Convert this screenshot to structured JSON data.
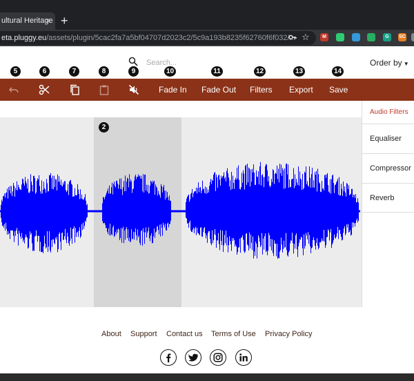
{
  "browser": {
    "tab_title": "ultural Heritage",
    "tab_close": "×",
    "new_tab": "+",
    "url_host": "eta.pluggy.eu",
    "url_path": "/assets/plugin/5cac2fa7a5bf04707d2023c2/5c9a193b8235f62760f6f032/..."
  },
  "extensions": [
    {
      "label": "M",
      "color": "#c0392b"
    },
    {
      "label": "",
      "color": "#2ecc71"
    },
    {
      "label": "",
      "color": "#3498db"
    },
    {
      "label": "",
      "color": "#27ae60"
    },
    {
      "label": "G",
      "color": "#16a085"
    },
    {
      "label": "SC",
      "color": "#e67e22"
    },
    {
      "label": "",
      "color": "#7f8c8d"
    }
  ],
  "header": {
    "search_placeholder": "Search...",
    "order_by": "Order by",
    "order_caret": "▼"
  },
  "badges": [
    "5",
    "6",
    "7",
    "8",
    "9",
    "10",
    "11",
    "12",
    "13",
    "14"
  ],
  "selection_badge": "2",
  "toolbar": {
    "fade_in": "Fade In",
    "fade_out": "Fade Out",
    "filters": "Filters",
    "export": "Export",
    "save": "Save",
    "icons": [
      "undo-icon",
      "cut-icon",
      "copy-icon",
      "paste-icon",
      "mute-icon"
    ]
  },
  "panel": {
    "title": "Audio Filters",
    "items": [
      "Equaliser",
      "Compressor",
      "Reverb"
    ]
  },
  "footer": {
    "links": [
      "About",
      "Support",
      "Contact us",
      "Terms of Use",
      "Privacy Policy"
    ],
    "social": [
      "facebook-icon",
      "twitter-icon",
      "instagram-icon",
      "linkedin-icon"
    ]
  },
  "colors": {
    "toolbar": "#8b3218",
    "waveform": "#0000ff",
    "accent": "#c0392b"
  }
}
